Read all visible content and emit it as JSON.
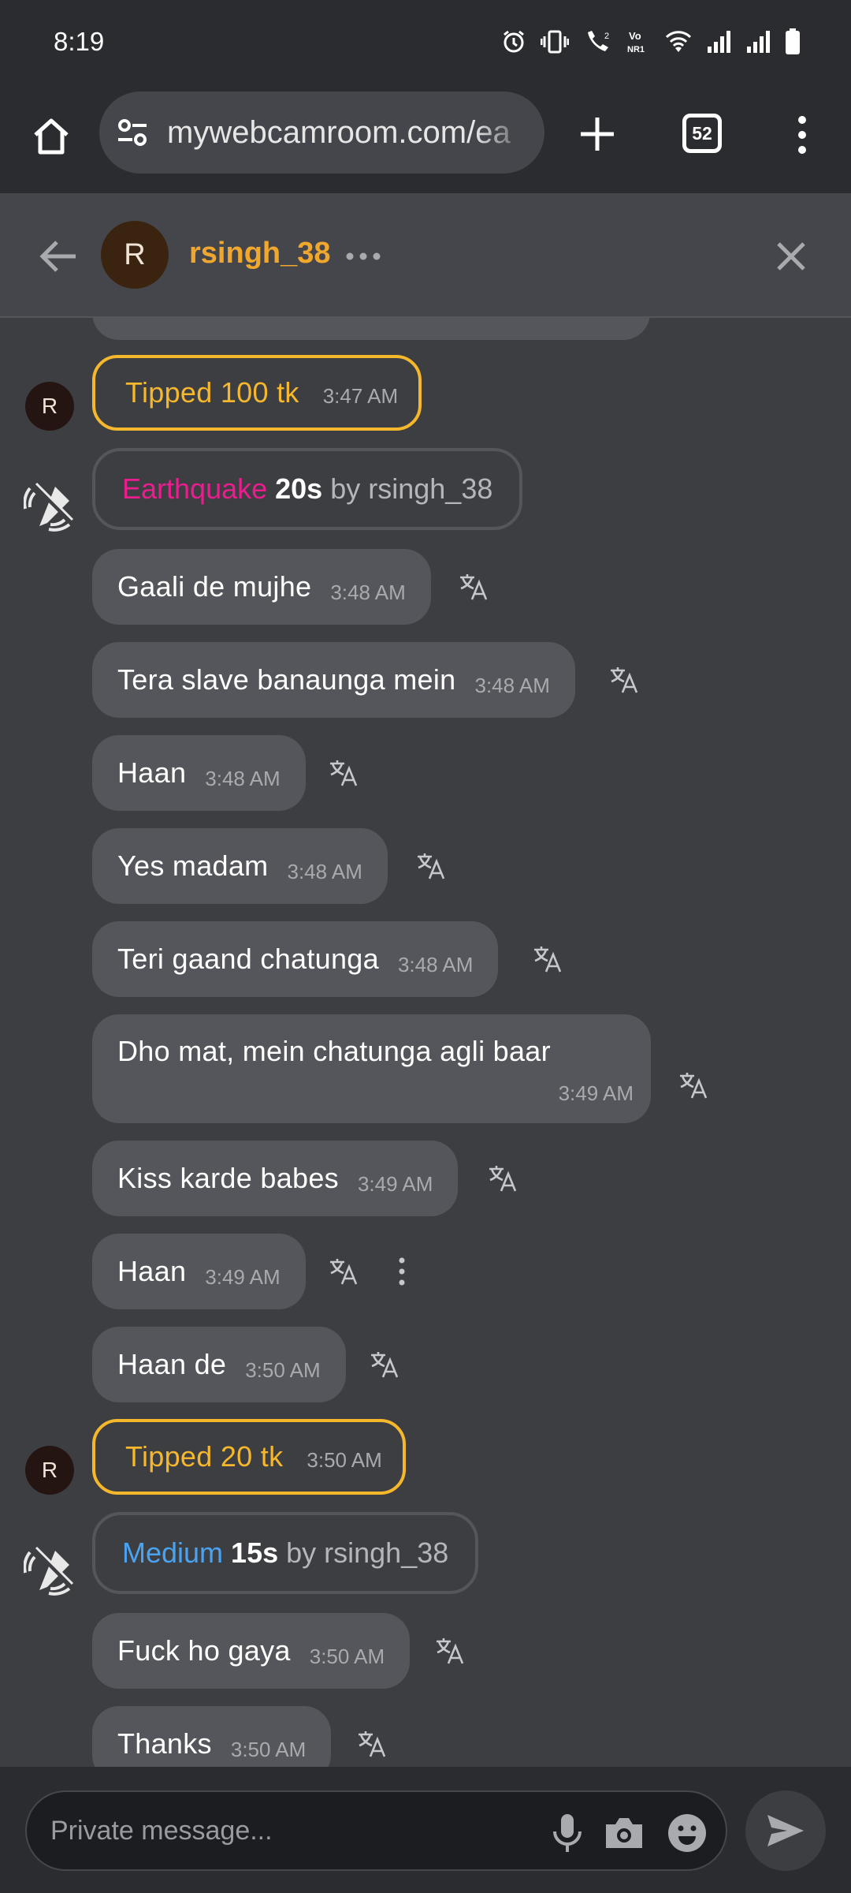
{
  "status_bar": {
    "time": "8:19",
    "icons": [
      "alarm-icon",
      "vibrate-icon",
      "wifi-calling-icon",
      "volte-icon",
      "wifi-icon",
      "signal-icon",
      "signal-icon",
      "battery-icon"
    ]
  },
  "browser": {
    "url": "mywebcamroom.com/ea",
    "tab_count": "52"
  },
  "chat": {
    "avatar_letter": "R",
    "username": "rsingh_38"
  },
  "messages": [
    {
      "type": "tip",
      "text": "Tipped 100 tk",
      "time": "3:47 AM"
    },
    {
      "type": "effect",
      "kind": "Earthquake",
      "duration": "20s",
      "by": "by rsingh_38"
    },
    {
      "type": "text",
      "text": "Gaali de mujhe",
      "time": "3:48 AM"
    },
    {
      "type": "text",
      "text": "Tera slave banaunga mein",
      "time": "3:48 AM"
    },
    {
      "type": "text",
      "text": "Haan",
      "time": "3:48 AM"
    },
    {
      "type": "text",
      "text": "Yes madam",
      "time": "3:48 AM"
    },
    {
      "type": "text",
      "text": "Teri gaand chatunga",
      "time": "3:48 AM"
    },
    {
      "type": "text",
      "text": "Dho mat, mein chatunga agli baar",
      "time": "3:49 AM"
    },
    {
      "type": "text",
      "text": "Kiss karde babes",
      "time": "3:49 AM"
    },
    {
      "type": "text",
      "text": "Haan",
      "time": "3:49 AM"
    },
    {
      "type": "text",
      "text": "Haan de",
      "time": "3:50 AM"
    },
    {
      "type": "tip",
      "text": "Tipped 20 tk",
      "time": "3:50 AM"
    },
    {
      "type": "effect",
      "kind": "Medium",
      "duration": "15s",
      "by": "by rsingh_38"
    },
    {
      "type": "text",
      "text": "Fuck ho gaya",
      "time": "3:50 AM"
    },
    {
      "type": "text",
      "text": "Thanks",
      "time": "3:50 AM"
    }
  ],
  "input": {
    "placeholder": "Private message..."
  },
  "colors": {
    "tip": "#f5b72c",
    "earthquake": "#ea1d8e",
    "medium": "#4aa3f0",
    "username": "#f0a72d",
    "bubble": "#55565b",
    "background": "#3d3e42"
  }
}
